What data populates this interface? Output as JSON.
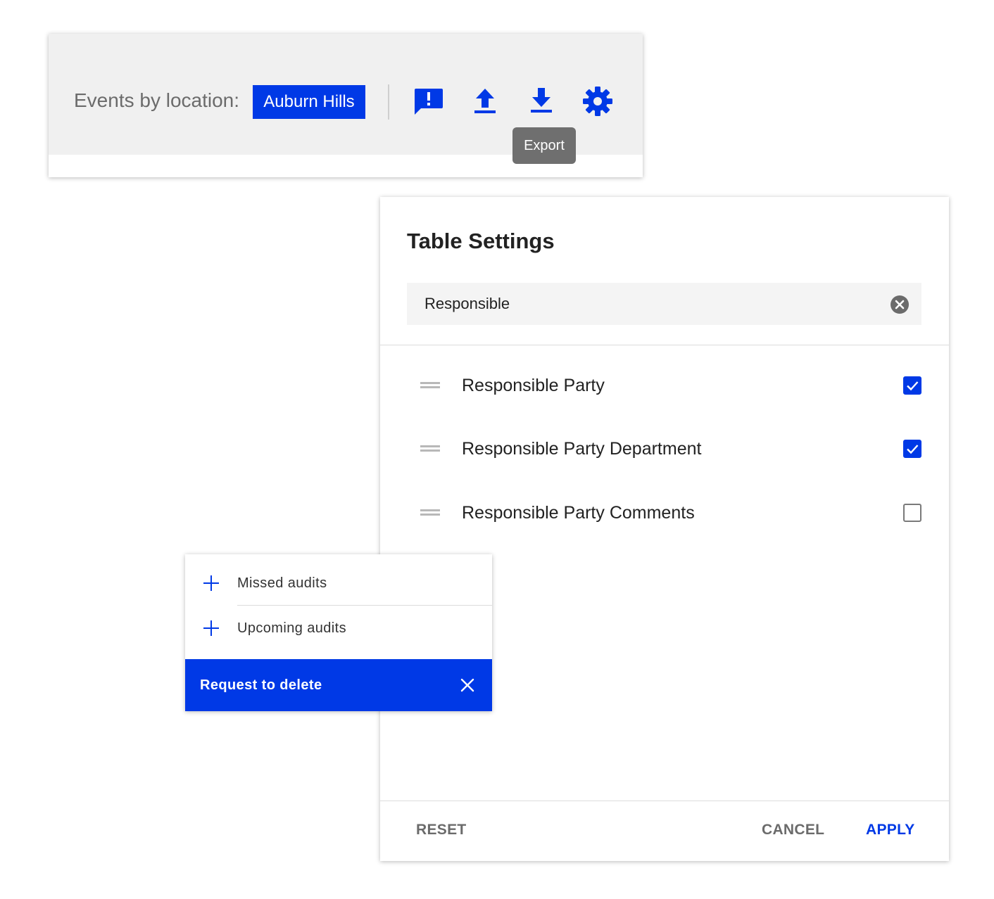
{
  "toolbar": {
    "label": "Events by location:",
    "location": "Auburn Hills",
    "tooltip": "Export",
    "icons": [
      "feedback-icon",
      "upload-icon",
      "download-icon",
      "gear-icon"
    ],
    "accent_color": "#0039e6"
  },
  "settings": {
    "title": "Table Settings",
    "search_value": "Responsible",
    "columns": [
      {
        "label": "Responsible Party",
        "checked": true
      },
      {
        "label": "Responsible Party Department",
        "checked": true
      },
      {
        "label": "Responsible Party Comments",
        "checked": false
      }
    ],
    "footer": {
      "reset": "RESET",
      "cancel": "CANCEL",
      "apply": "APPLY"
    }
  },
  "menu": {
    "items": [
      {
        "label": "Missed audits"
      },
      {
        "label": "Upcoming audits"
      }
    ],
    "action": "Request to delete"
  }
}
